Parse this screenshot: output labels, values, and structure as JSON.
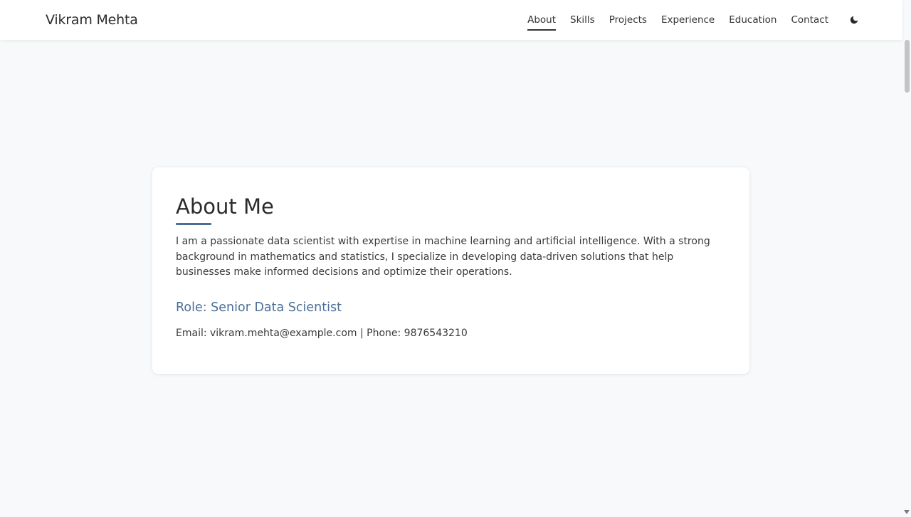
{
  "navbar": {
    "brand": "Vikram Mehta",
    "links": [
      {
        "label": "About",
        "active": true
      },
      {
        "label": "Skills",
        "active": false
      },
      {
        "label": "Projects",
        "active": false
      },
      {
        "label": "Experience",
        "active": false
      },
      {
        "label": "Education",
        "active": false
      },
      {
        "label": "Contact",
        "active": false
      }
    ],
    "theme_toggle_icon": "moon-icon"
  },
  "about": {
    "title": "About Me",
    "text": "I am a passionate data scientist with expertise in machine learning and artificial intelligence. With a strong background in mathematics and statistics, I specialize in developing data-driven solutions that help businesses make informed decisions and optimize their operations.",
    "role": "Role: Senior Data Scientist",
    "contact": "Email: vikram.mehta@example.com | Phone: 9876543210"
  },
  "colors": {
    "accent": "#4a6f96",
    "background": "#f8f9fa",
    "card": "#ffffff",
    "text": "#333333"
  }
}
